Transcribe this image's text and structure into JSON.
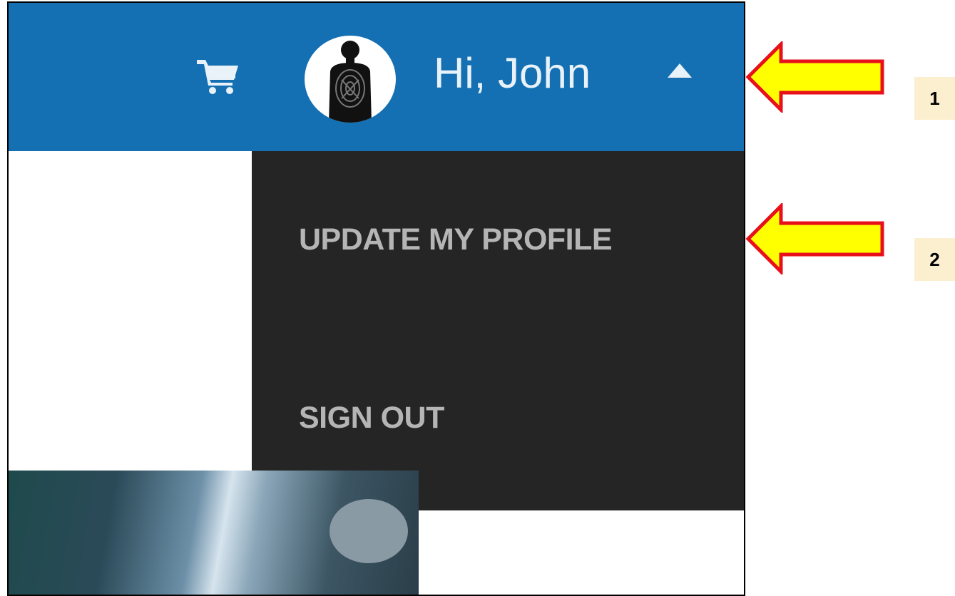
{
  "header": {
    "greeting": "Hi, John",
    "icons": {
      "cart": "shopping-cart-icon",
      "avatar": "target-silhouette-avatar",
      "caret": "caret-up-icon"
    }
  },
  "menu": {
    "items": [
      {
        "label": "UPDATE MY PROFILE"
      },
      {
        "label": "SIGN OUT"
      }
    ]
  },
  "annotations": {
    "callouts": [
      "1",
      "2"
    ]
  },
  "colors": {
    "header_bg": "#1470b2",
    "dropdown_bg": "#262525",
    "menu_text": "#b5b5b5",
    "arrow_fill": "#ffff00",
    "arrow_stroke": "#e8101a",
    "badge_bg": "#fcefcf"
  }
}
